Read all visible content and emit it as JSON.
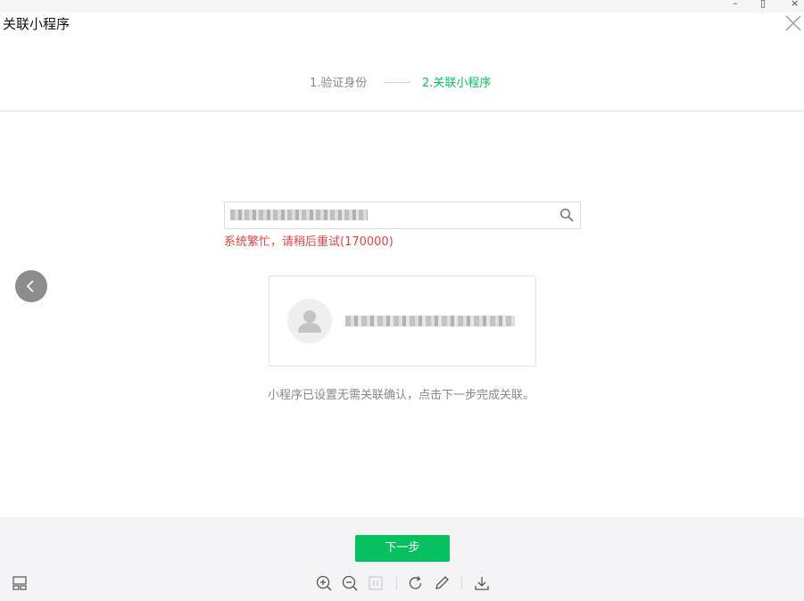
{
  "window": {
    "title": "关联小程序",
    "minimize_glyph": "–",
    "maximize_glyph": "▯",
    "close_glyph": "×"
  },
  "steps": [
    {
      "label": "1.验证身份",
      "state": "done"
    },
    {
      "label": "2.关联小程序",
      "state": "active"
    }
  ],
  "search": {
    "value_obscured": true,
    "error_text": "系统繁忙，请稍后重试(170000)"
  },
  "result_card": {
    "name_obscured": true,
    "icon": "default-avatar-icon"
  },
  "note": "小程序已设置无需关联确认，点击下一步完成关联。",
  "footer": {
    "next_label": "下一步"
  },
  "toolbar_icons": [
    "layout-icon",
    "zoom-in-icon",
    "zoom-out-icon",
    "fit-icon",
    "rotate-icon",
    "edit-icon",
    "download-icon"
  ],
  "colors": {
    "accent": "#07c160",
    "error": "#e64340",
    "footer_bg": "#f4f4f6"
  }
}
